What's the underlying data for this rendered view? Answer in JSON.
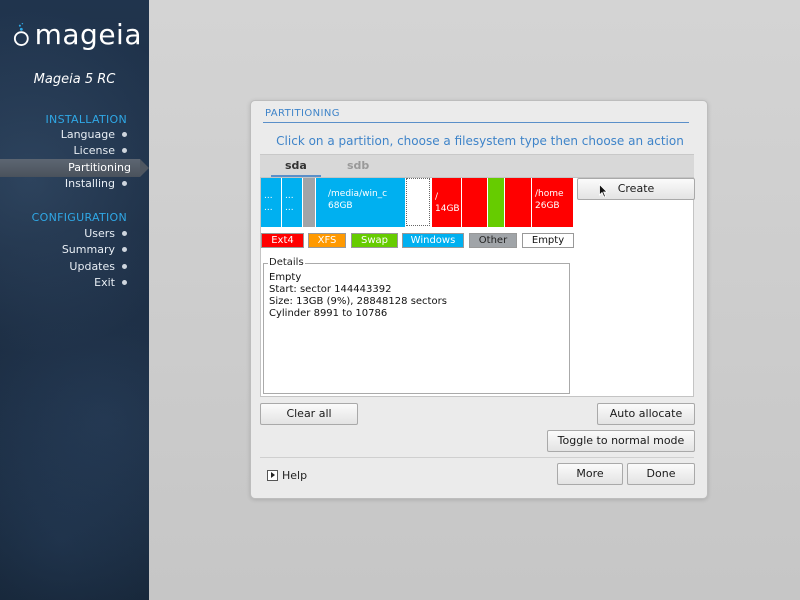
{
  "sidebar": {
    "logo_text": "mageia",
    "edition": "Mageia 5 RC",
    "sections": [
      {
        "label": "INSTALLATION",
        "items": [
          {
            "label": "Language",
            "active": false
          },
          {
            "label": "License",
            "active": false
          },
          {
            "label": "Partitioning",
            "active": true
          },
          {
            "label": "Installing",
            "active": false
          }
        ]
      },
      {
        "label": "CONFIGURATION",
        "items": [
          {
            "label": "Users",
            "active": false
          },
          {
            "label": "Summary",
            "active": false
          },
          {
            "label": "Updates",
            "active": false
          },
          {
            "label": "Exit",
            "active": false
          }
        ]
      }
    ]
  },
  "dialog": {
    "title": "PARTITIONING",
    "instruction": "Click on a partition, choose a filesystem type then choose an action",
    "tabs": [
      {
        "label": "sda",
        "active": true
      },
      {
        "label": "sdb",
        "active": false
      }
    ],
    "partitions": [
      {
        "line1": "...",
        "line2": "...",
        "type": "Windows"
      },
      {
        "line1": "...",
        "line2": "...",
        "type": "Windows"
      },
      {
        "line1": "",
        "line2": "",
        "type": "Other"
      },
      {
        "line1": "/media/win_c",
        "line2": "68GB",
        "type": "Windows"
      },
      {
        "line1": "",
        "line2": "",
        "type": "Empty"
      },
      {
        "line1": "/",
        "line2": "14GB",
        "type": "Ext4"
      },
      {
        "line1": "",
        "line2": "",
        "type": "Ext4"
      },
      {
        "line1": "",
        "line2": "",
        "type": "Swap"
      },
      {
        "line1": "",
        "line2": "",
        "type": "Ext4"
      },
      {
        "line1": "/home",
        "line2": "26GB",
        "type": "Ext4"
      }
    ],
    "legend": [
      {
        "label": "Ext4",
        "color": "#ff0000",
        "text_color": "#ffffff"
      },
      {
        "label": "XFS",
        "color": "#ff9900",
        "text_color": "#ffffff"
      },
      {
        "label": "Swap",
        "color": "#66cc00",
        "text_color": "#ffffff"
      },
      {
        "label": "Windows",
        "color": "#00b0f0",
        "text_color": "#ffffff"
      },
      {
        "label": "Other",
        "color": "#a0a4a8",
        "text_color": "#222222"
      },
      {
        "label": "Empty",
        "color": "#ffffff",
        "text_color": "#111111"
      }
    ],
    "details": {
      "label": "Details",
      "lines": [
        "Empty",
        "Start: sector 144443392",
        "Size: 13GB (9%), 28848128 sectors",
        "Cylinder 8991 to 10786"
      ]
    },
    "buttons": {
      "create": "Create",
      "clear_all": "Clear all",
      "auto_allocate": "Auto allocate",
      "toggle_mode": "Toggle to normal mode",
      "more": "More",
      "done": "Done"
    },
    "help_label": "Help"
  },
  "colors": {
    "ext4": "#ff0000",
    "swap": "#66cc00",
    "windows": "#00b0f0",
    "other": "#a0a4a8",
    "accent": "#3f84c9"
  }
}
